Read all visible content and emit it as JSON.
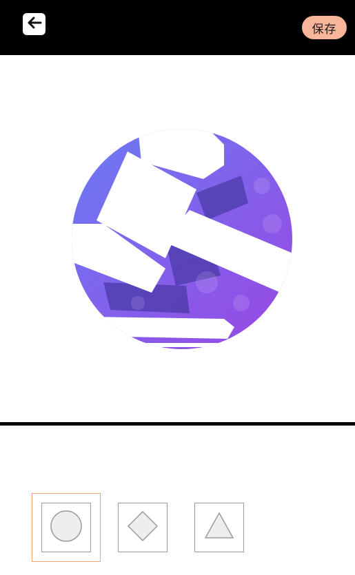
{
  "toolbar": {
    "back_icon": "arrow-left-icon",
    "save_label": "保存",
    "save_color": "#f7b59a"
  },
  "preview": {
    "shape": "circle",
    "gradient": [
      "#6f78f2",
      "#9a49e3"
    ]
  },
  "shape_options": [
    {
      "name": "circle",
      "selected": true
    },
    {
      "name": "diamond",
      "selected": false
    },
    {
      "name": "triangle",
      "selected": false
    }
  ],
  "colors": {
    "selection_border": "#f5a37a",
    "topbar": "#000000"
  }
}
